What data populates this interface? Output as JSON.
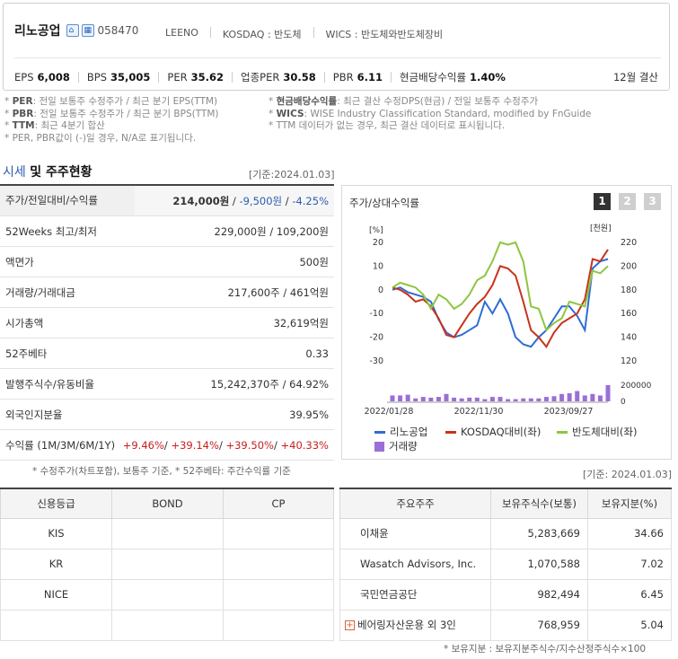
{
  "header": {
    "company_name": "리노공업",
    "home_icon": "home-icon",
    "ir_icon": "building-icon",
    "code": "058470",
    "meta": [
      "LEENO",
      "KOSDAQ : 반도체",
      "WICS : 반도체와반도체장비"
    ],
    "stats": [
      {
        "label": "EPS",
        "value": "6,008"
      },
      {
        "label": "BPS",
        "value": "35,005"
      },
      {
        "label": "PER",
        "value": "35.62"
      },
      {
        "label": "업종PER",
        "value": "30.58"
      },
      {
        "label": "PBR",
        "value": "6.11"
      },
      {
        "label": "현금배당수익률",
        "value": "1.40%"
      }
    ],
    "fiscal": "12월 결산"
  },
  "notes_left": [
    {
      "key": "PER",
      "text": ": 전일 보통주 수정주가 / 최근 분기 EPS(TTM)"
    },
    {
      "key": "PBR",
      "text": ": 전일 보통주 수정주가 / 최근 분기 BPS(TTM)"
    },
    {
      "key": "TTM",
      "text": ": 최근 4분기 합산"
    },
    {
      "key": "",
      "text": "PER, PBR값이 (-)일 경우, N/A로 표기됩니다."
    }
  ],
  "notes_right": [
    {
      "key": "현금배당수익률",
      "text": ": 최근 결산 수정DPS(현금) / 전일 보통주 수정주가"
    },
    {
      "key": "WICS",
      "text": ": WISE Industry Classification Standard, modified by FnGuide"
    },
    {
      "key": "",
      "text": "TTM 데이터가 없는 경우, 최근 결산 데이터로 표시됩니다."
    }
  ],
  "section": {
    "title_accent": "시세",
    "title_rest": "및 주주현황",
    "date": "[기준:2024.01.03]"
  },
  "price_table": {
    "row0": {
      "label": "주가/전일대비/수익률",
      "price": "214,000원",
      "change": "-9,500원",
      "pct": "-4.25%"
    },
    "rows": [
      {
        "label": "52Weeks 최고/최저",
        "value": "229,000원 / 109,200원"
      },
      {
        "label": "액면가",
        "value": "500원"
      },
      {
        "label": "거래량/거래대금",
        "value": "217,600주 / 461억원"
      },
      {
        "label": "시가총액",
        "value": "32,619억원"
      },
      {
        "label": "52주베타",
        "value": "0.33"
      },
      {
        "label": "발행주식수/유동비율",
        "value": "15,242,370주 / 64.92%"
      },
      {
        "label": "외국인지분율",
        "value": "39.95%"
      }
    ],
    "returns": {
      "label": "수익률 (1M/3M/6M/1Y)",
      "v1": "+9.46%",
      "v2": "+39.14%",
      "v3": "+39.50%",
      "v4": "+40.33%"
    },
    "footnote": "* 수정주가(차트포함), 보통주 기준, * 52주베타: 주간수익률 기준"
  },
  "chart_panel": {
    "title": "주가/상대수익률",
    "buttons": [
      "1",
      "2",
      "3"
    ],
    "left_unit": "[%]",
    "right_unit": "[천원]"
  },
  "chart_data": {
    "type": "line",
    "y_left": {
      "ticks": [
        "20",
        "10",
        "0",
        "-10",
        "-20",
        "-30"
      ],
      "range": [
        -30,
        20
      ]
    },
    "y_right": {
      "ticks": [
        "220",
        "200",
        "180",
        "160",
        "140",
        "120"
      ],
      "range": [
        120,
        220
      ]
    },
    "volume_axis": {
      "ticks": [
        "200000",
        "0"
      ]
    },
    "x_ticks": [
      "2022/01/28",
      "2022/11/30",
      "2023/09/27"
    ],
    "series": [
      {
        "name": "리노공업",
        "color": "#2f6bd6",
        "axis": "right",
        "values": [
          180,
          182,
          178,
          176,
          174,
          170,
          155,
          144,
          140,
          142,
          146,
          150,
          170,
          160,
          172,
          160,
          140,
          134,
          132,
          140,
          146,
          156,
          166,
          166,
          158,
          146,
          198,
          204,
          206
        ]
      },
      {
        "name": "KOSDAQ대비(좌)",
        "color": "#c8331a",
        "axis": "left",
        "values": [
          1,
          0,
          -2,
          -5,
          -4,
          -7,
          -12,
          -19,
          -20,
          -15,
          -10,
          -6,
          -3,
          2,
          10,
          9,
          6,
          -5,
          -17,
          -20,
          -24,
          -18,
          -14,
          -12,
          -10,
          -4,
          13,
          12,
          17
        ]
      },
      {
        "name": "반도체대비(좌)",
        "color": "#8dc63f",
        "axis": "left",
        "values": [
          1,
          3,
          2,
          1,
          -2,
          -8,
          -2,
          -4,
          -8,
          -6,
          -2,
          4,
          6,
          12,
          20,
          19,
          20,
          12,
          -7,
          -8,
          -17,
          -14,
          -12,
          -5,
          -6,
          -7,
          8,
          7,
          10
        ]
      }
    ],
    "volume": {
      "name": "거래량",
      "color": "#9b6fd6",
      "values": [
        0.8,
        0.8,
        0.9,
        0.4,
        0.6,
        0.5,
        0.6,
        1.0,
        0.5,
        0.4,
        0.5,
        0.5,
        0.3,
        0.6,
        0.6,
        0.3,
        0.3,
        0.4,
        0.4,
        0.4,
        0.6,
        0.7,
        1.0,
        1.1,
        1.4,
        0.8,
        1.0,
        0.8,
        2.2
      ]
    },
    "legend": [
      "리노공업",
      "KOSDAQ대비(좌)",
      "반도체대비(좌)",
      "거래량"
    ]
  },
  "date2": "[기준: 2024.01.03]",
  "credit": {
    "headers": [
      "신용등급",
      "BOND",
      "CP"
    ],
    "rows": [
      [
        "KIS",
        "",
        ""
      ],
      [
        "KR",
        "",
        ""
      ],
      [
        "NICE",
        "",
        ""
      ],
      [
        "",
        "",
        ""
      ]
    ]
  },
  "holders": {
    "headers": [
      "주요주주",
      "보유주식수(보통)",
      "보유지분(%)"
    ],
    "rows": [
      {
        "name": "이채윤",
        "shares": "5,283,669",
        "pct": "34.66"
      },
      {
        "name": "Wasatch Advisors, Inc.",
        "shares": "1,070,588",
        "pct": "7.02"
      },
      {
        "name": "국민연금공단",
        "shares": "982,494",
        "pct": "6.45"
      },
      {
        "name": "베어링자산운용 외 3인",
        "shares": "768,959",
        "pct": "5.04"
      }
    ],
    "plus_icon": "plus-icon",
    "footnote": "* 보유지분 : 보유지분주식수/지수산정주식수×100"
  }
}
